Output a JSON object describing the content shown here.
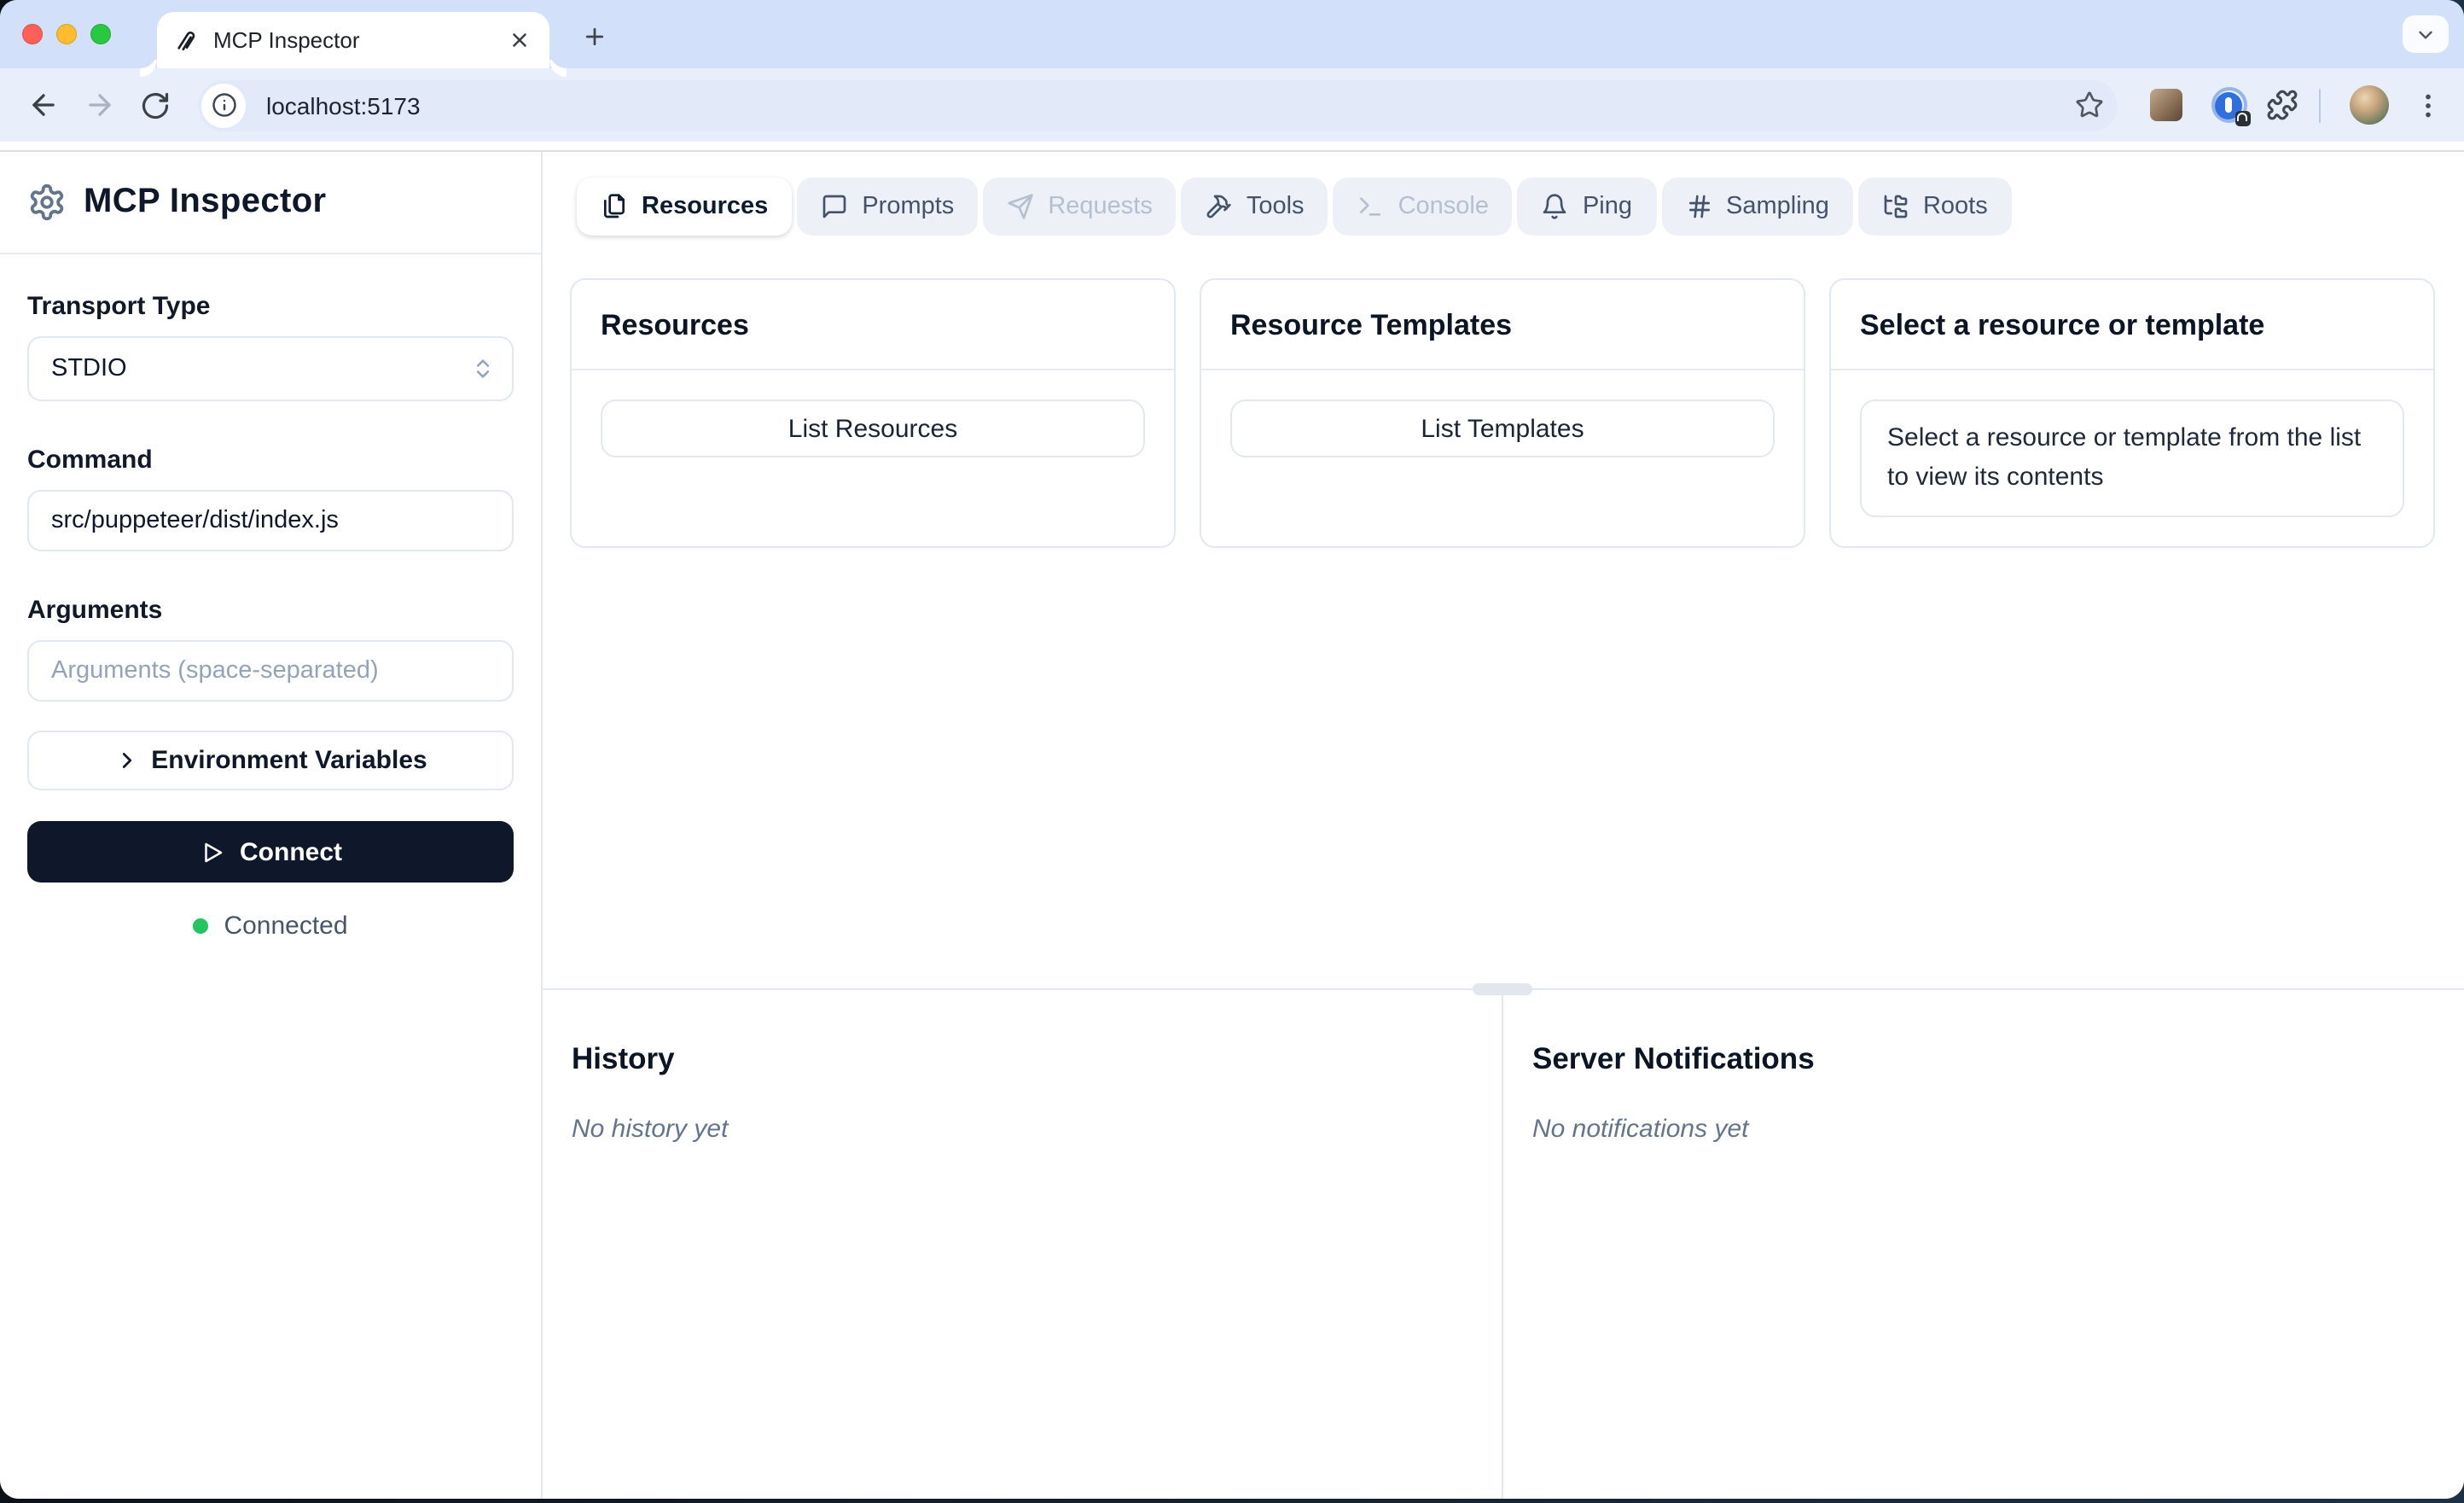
{
  "browser": {
    "tab": {
      "title": "MCP Inspector"
    },
    "address": {
      "url": "localhost:5173"
    }
  },
  "app": {
    "sidebar": {
      "title": "MCP Inspector",
      "transport_label": "Transport Type",
      "transport_value": "STDIO",
      "command_label": "Command",
      "command_value": "src/puppeteer/dist/index.js",
      "arguments_label": "Arguments",
      "arguments_placeholder": "Arguments (space-separated)",
      "env_button_label": "Environment Variables",
      "connect_label": "Connect",
      "status_label": "Connected",
      "status_color": "#22c55e"
    },
    "tabs": {
      "items": [
        {
          "id": "resources",
          "label": "Resources",
          "icon": "files-icon",
          "state": "active"
        },
        {
          "id": "prompts",
          "label": "Prompts",
          "icon": "message-icon",
          "state": "enabled"
        },
        {
          "id": "requests",
          "label": "Requests",
          "icon": "send-icon",
          "state": "disabled"
        },
        {
          "id": "tools",
          "label": "Tools",
          "icon": "hammer-icon",
          "state": "enabled"
        },
        {
          "id": "console",
          "label": "Console",
          "icon": "terminal-icon",
          "state": "disabled"
        },
        {
          "id": "ping",
          "label": "Ping",
          "icon": "bell-icon",
          "state": "enabled"
        },
        {
          "id": "sampling",
          "label": "Sampling",
          "icon": "hash-icon",
          "state": "enabled"
        },
        {
          "id": "roots",
          "label": "Roots",
          "icon": "folder-tree-icon",
          "state": "enabled"
        }
      ]
    },
    "panels": {
      "resources": {
        "title": "Resources",
        "button_label": "List Resources"
      },
      "templates": {
        "title": "Resource Templates",
        "button_label": "List Templates"
      },
      "preview": {
        "title": "Select a resource or template",
        "message": "Select a resource or template from the list to view its contents"
      }
    },
    "history": {
      "title": "History",
      "empty_message": "No history yet"
    },
    "notifications": {
      "title": "Server Notifications",
      "empty_message": "No notifications yet"
    }
  },
  "colors": {
    "accent_dark": "#0f172a",
    "tabstrip": "#d3e0fa",
    "toolbar": "#e9eefb",
    "border": "#e2e8f0"
  }
}
